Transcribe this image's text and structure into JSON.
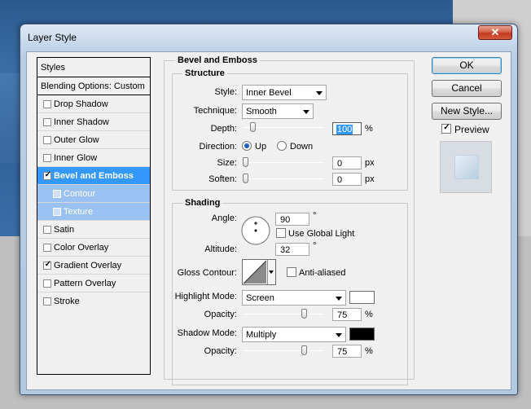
{
  "window": {
    "title": "Layer Style",
    "close_glyph": "✕"
  },
  "styles_list": {
    "header": "Styles",
    "blending": "Blending Options: Custom",
    "items": [
      {
        "label": "Drop Shadow",
        "checked": false
      },
      {
        "label": "Inner Shadow",
        "checked": false
      },
      {
        "label": "Outer Glow",
        "checked": false
      },
      {
        "label": "Inner Glow",
        "checked": false
      },
      {
        "label": "Bevel and Emboss",
        "checked": true,
        "selected": true
      },
      {
        "label": "Contour",
        "checked": false,
        "sub": true
      },
      {
        "label": "Texture",
        "checked": false,
        "sub": true
      },
      {
        "label": "Satin",
        "checked": false
      },
      {
        "label": "Color Overlay",
        "checked": false
      },
      {
        "label": "Gradient Overlay",
        "checked": true
      },
      {
        "label": "Pattern Overlay",
        "checked": false
      },
      {
        "label": "Stroke",
        "checked": false
      }
    ],
    "check_glyph": "✓"
  },
  "bevel": {
    "title": "Bevel and Emboss",
    "structure": {
      "title": "Structure",
      "style_label": "Style:",
      "style_value": "Inner Bevel",
      "technique_label": "Technique:",
      "technique_value": "Smooth",
      "depth_label": "Depth:",
      "depth_value": "100",
      "depth_unit": "%",
      "direction_label": "Direction:",
      "direction_up": "Up",
      "direction_down": "Down",
      "size_label": "Size:",
      "size_value": "0",
      "size_unit": "px",
      "soften_label": "Soften:",
      "soften_value": "0",
      "soften_unit": "px"
    },
    "shading": {
      "title": "Shading",
      "angle_label": "Angle:",
      "angle_value": "90",
      "angle_unit": "°",
      "global_light_label": "Use Global Light",
      "altitude_label": "Altitude:",
      "altitude_value": "32",
      "altitude_unit": "°",
      "gloss_label": "Gloss Contour:",
      "anti_aliased_label": "Anti-aliased",
      "highlight_mode_label": "Highlight Mode:",
      "highlight_mode_value": "Screen",
      "highlight_color": "#ffffff",
      "highlight_opacity_label": "Opacity:",
      "highlight_opacity_value": "75",
      "highlight_opacity_unit": "%",
      "shadow_mode_label": "Shadow Mode:",
      "shadow_mode_value": "Multiply",
      "shadow_color": "#000000",
      "shadow_opacity_label": "Opacity:",
      "shadow_opacity_value": "75",
      "shadow_opacity_unit": "%"
    }
  },
  "buttons": {
    "ok": "OK",
    "cancel": "Cancel",
    "new_style": "New Style...",
    "preview_label": "Preview"
  }
}
